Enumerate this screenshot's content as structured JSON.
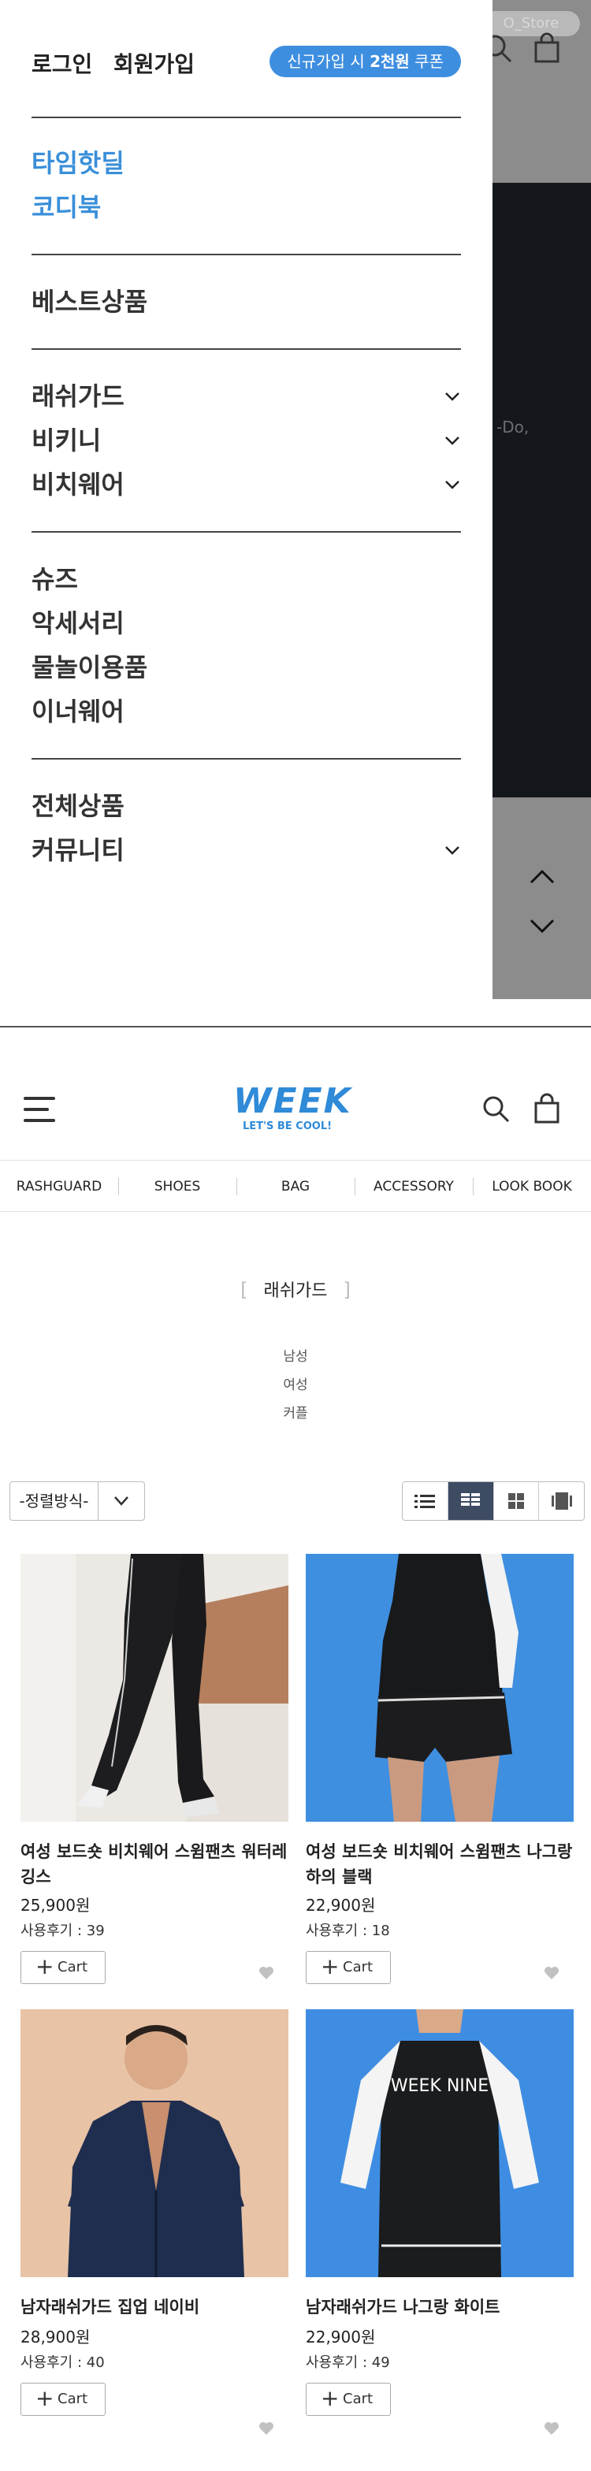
{
  "overlay": {
    "store_pill": "O_Store",
    "side_text": "-Do,"
  },
  "drawer": {
    "login": "로그인",
    "signup": "회원가입",
    "coupon_prefix": "신규가입 시 ",
    "coupon_bold": "2천원",
    "coupon_suffix": " 쿠폰",
    "group1": [
      "타임핫딜",
      "코디북"
    ],
    "group2": [
      "베스트상품"
    ],
    "group3": [
      "래쉬가드",
      "비키니",
      "비치웨어"
    ],
    "group4": [
      "슈즈",
      "악세서리",
      "물놀이용품",
      "이너웨어"
    ],
    "group5": [
      "전체상품",
      "커뮤니티"
    ]
  },
  "header": {
    "logo": "WEEK",
    "logo_sub": "LET'S BE COOL!"
  },
  "category_nav": [
    "RASHGUARD",
    "SHOES",
    "BAG",
    "ACCESSORY",
    "LOOK BOOK"
  ],
  "category": {
    "title": "래쉬가드",
    "subcategories": [
      "남성",
      "여성",
      "커플"
    ]
  },
  "sort": {
    "label": "-정렬방식-"
  },
  "products": [
    {
      "name": "여성 보드숏 비치웨어 스윔팬츠 워터레깅스",
      "price": "25,900원",
      "review": "사용후기 : 39",
      "cart": "Cart"
    },
    {
      "name": "여성 보드숏 비치웨어 스윔팬츠 나그랑 하의 블랙",
      "price": "22,900원",
      "review": "사용후기 : 18",
      "cart": "Cart"
    },
    {
      "name": "남자래쉬가드 집업 네이비",
      "price": "28,900원",
      "review": "사용후기 : 40",
      "cart": "Cart"
    },
    {
      "name": "남자래쉬가드 나그랑 화이트",
      "price": "22,900원",
      "review": "사용후기 : 49",
      "cart": "Cart"
    }
  ],
  "product_images": {
    "shirt_print": "WEEK NINE"
  },
  "colors": {
    "accent": "#3e8ee0",
    "logo": "#2f8ad8",
    "active_view": "#3d4b63"
  }
}
